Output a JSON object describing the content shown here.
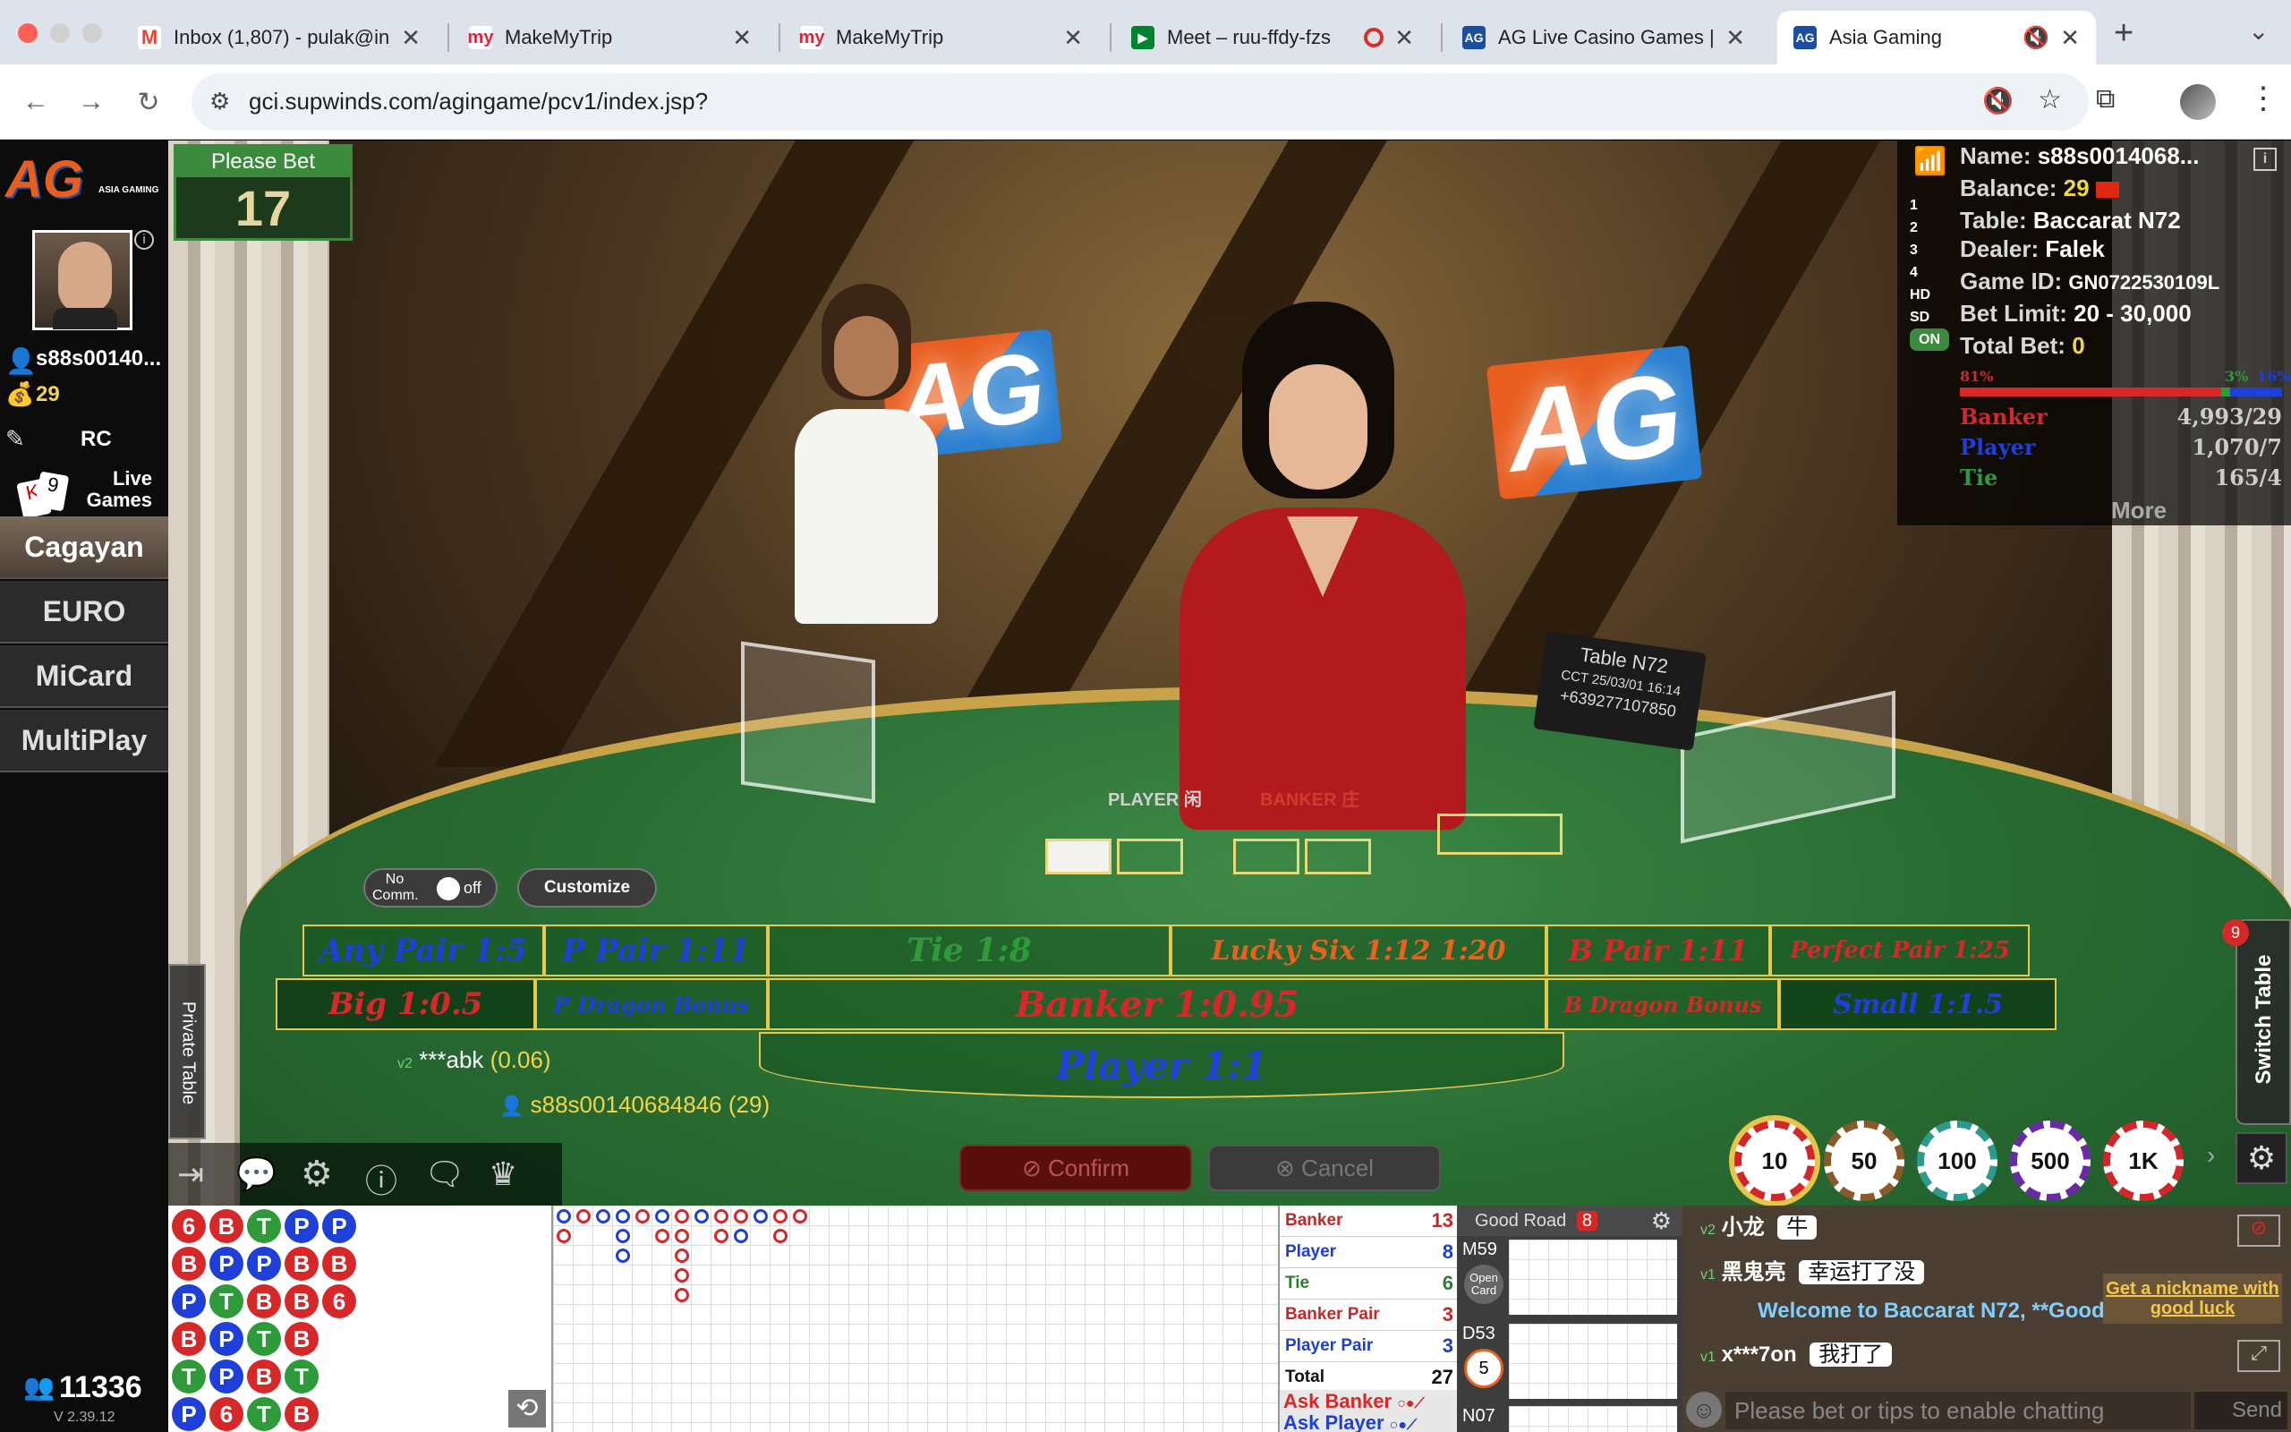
{
  "browser": {
    "tabs": [
      {
        "title": "Inbox (1,807) - pulak@in",
        "icon": "gmail-icon",
        "color": "#ea4335"
      },
      {
        "title": "MakeMyTrip",
        "icon": "makemytrip-icon",
        "color": "#e0233a"
      },
      {
        "title": "MakeMyTrip",
        "icon": "makemytrip-icon",
        "color": "#e0233a"
      },
      {
        "title": "Meet – ruu-ffdy-fzs",
        "icon": "meet-icon",
        "color": "#00832d"
      },
      {
        "title": "AG Live Casino Games |",
        "icon": "ag-icon",
        "color": "#1a4ea0"
      },
      {
        "title": "Asia Gaming",
        "icon": "ag-icon",
        "color": "#1a4ea0"
      }
    ],
    "url": "gci.supwinds.com/agingame/pcv1/index.jsp?"
  },
  "left": {
    "logo": "AG",
    "logo_sub": "ASIA GAMING",
    "username": "s88s00140...",
    "balance": "29",
    "rc_label": "RC",
    "live_games": "Live Games",
    "menu": [
      "Cagayan",
      "EURO",
      "MiCard",
      "MultiPlay"
    ],
    "online_count": "11336",
    "version": "V 2.39.12"
  },
  "bet_status": {
    "label": "Please Bet",
    "countdown": "17"
  },
  "info": {
    "name_label": "Name:",
    "name": "s88s0014068...",
    "balance_label": "Balance:",
    "balance": "29",
    "table_label": "Table:",
    "table": "Baccarat N72",
    "dealer_label": "Dealer:",
    "dealer": "Falek",
    "gameid_label": "Game ID:",
    "gameid": "GN0722530109L",
    "betlimit_label": "Bet Limit:",
    "betlimit": "20 - 30,000",
    "totalbet_label": "Total Bet:",
    "totalbet": "0",
    "pct_banker": "81%",
    "pct_player": "3%",
    "pct_tie": "16%",
    "banker_label": "Banker",
    "banker_val": "4,993/29",
    "player_label": "Player",
    "player_val": "1,070/7",
    "tie_label": "Tie",
    "tie_val": "165/4",
    "more": "More",
    "lines": [
      "1",
      "2",
      "3",
      "4",
      "HD",
      "SD",
      "ON"
    ]
  },
  "table_sign": {
    "title": "Table N72",
    "cct": "CCT 25/03/01 16:14",
    "phone": "+639277107850"
  },
  "table_labels": {
    "player": "PLAYER 闲",
    "banker": "BANKER 庄"
  },
  "bets": {
    "any_pair": "Any Pair  1:5",
    "p_pair": "P Pair  1:11",
    "tie": "Tie  1:8",
    "lucky_six": "Lucky Six  1:12  1:20",
    "b_pair": "B Pair  1:11",
    "perfect_pair": "Perfect Pair  1:25",
    "big": "Big  1:0.5",
    "p_dragon": "P Dragon Bonus",
    "banker": "Banker  1:0.95",
    "b_dragon": "B Dragon Bonus",
    "small": "Small  1:1.5",
    "player": "Player  1:1"
  },
  "no_comm": {
    "label": "No Comm.",
    "state": "off"
  },
  "customize": "Customize",
  "players_on_table": [
    {
      "name": "***abk",
      "amount": "(0.06)"
    },
    {
      "name": "s88s00140684846",
      "amount": "(29)"
    }
  ],
  "actions": {
    "confirm": "Confirm",
    "cancel": "Cancel"
  },
  "chips": [
    {
      "value": "10",
      "color": "#d3262b"
    },
    {
      "value": "50",
      "color": "#8b5a2b"
    },
    {
      "value": "100",
      "color": "#2c9a8e"
    },
    {
      "value": "500",
      "color": "#6a2aa8"
    },
    {
      "value": "1K",
      "color": "#d3262b"
    }
  ],
  "switch_table": {
    "label": "Switch Table",
    "badge": "9"
  },
  "private_table": "Private Table",
  "stats": [
    {
      "label": "Banker",
      "value": "13",
      "color": "#c62828"
    },
    {
      "label": "Player",
      "value": "8",
      "color": "#1e40c8"
    },
    {
      "label": "Tie",
      "value": "6",
      "color": "#2e7d32"
    },
    {
      "label": "Banker Pair",
      "value": "3",
      "color": "#c62828"
    },
    {
      "label": "Player Pair",
      "value": "3",
      "color": "#1e40c8"
    },
    {
      "label": "Total",
      "value": "27",
      "color": "#111"
    }
  ],
  "ask": {
    "banker": "Ask Banker",
    "player": "Ask Player"
  },
  "good_road": {
    "label": "Good Road",
    "count": "8",
    "rooms": [
      "M59",
      "D53",
      "N07"
    ],
    "open_card": "Open Card",
    "timer": "5"
  },
  "bead_road": [
    [
      "6",
      "B",
      "T",
      "P",
      "P"
    ],
    [
      "B",
      "P",
      "P",
      "B",
      "B"
    ],
    [
      "P",
      "T",
      "B",
      "B",
      "6"
    ],
    [
      "B",
      "P",
      "T",
      "B",
      ""
    ],
    [
      "T",
      "P",
      "B",
      "T",
      ""
    ],
    [
      "P",
      "6",
      "T",
      "B",
      ""
    ]
  ],
  "chat": {
    "messages": [
      {
        "user": "小龙",
        "text": "牛"
      },
      {
        "user": "黑鬼亮",
        "text": "幸运打了没"
      },
      {
        "user": "x***7on",
        "text": "我打了"
      }
    ],
    "welcome": "Welcome to Baccarat N72, **Good",
    "nickname_promo": "Get a nickname with good luck",
    "placeholder": "Please bet or tips to enable chatting",
    "send": "Send"
  },
  "colors": {
    "banker": "#d62828",
    "player": "#1e3fd8",
    "tie": "#2e9a3a",
    "gold": "#e8c84a"
  }
}
